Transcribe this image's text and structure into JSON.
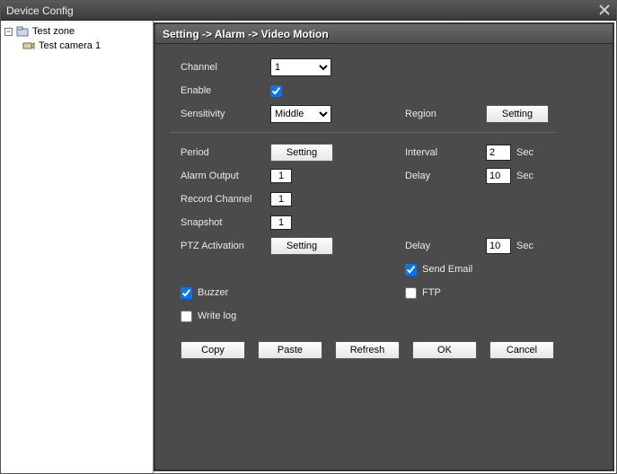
{
  "window": {
    "title": "Device Config"
  },
  "tree": {
    "root": "Test zone",
    "child": "Test camera 1"
  },
  "breadcrumb": "Setting -> Alarm -> Video Motion",
  "labels": {
    "channel": "Channel",
    "enable": "Enable",
    "sensitivity": "Sensitivity",
    "region": "Region",
    "period": "Period",
    "interval": "Interval",
    "alarm_output": "Alarm Output",
    "delay": "Delay",
    "record_channel": "Record Channel",
    "snapshot": "Snapshot",
    "ptz_activation": "PTZ Activation",
    "send_email": "Send Email",
    "buzzer": "Buzzer",
    "ftp": "FTP",
    "write_log": "Write log",
    "sec": "Sec"
  },
  "values": {
    "channel": "1",
    "enable_checked": true,
    "sensitivity": "Middle",
    "interval": "2",
    "alarm_output": "1",
    "delay_alarm": "10",
    "record_channel": "1",
    "snapshot": "1",
    "delay_ptz": "10",
    "send_email_checked": true,
    "buzzer_checked": true,
    "ftp_checked": false,
    "write_log_checked": false
  },
  "buttons": {
    "setting": "Setting",
    "copy": "Copy",
    "paste": "Paste",
    "refresh": "Refresh",
    "ok": "OK",
    "cancel": "Cancel"
  },
  "options": {
    "channel": [
      "1"
    ],
    "sensitivity": [
      "Middle"
    ]
  }
}
